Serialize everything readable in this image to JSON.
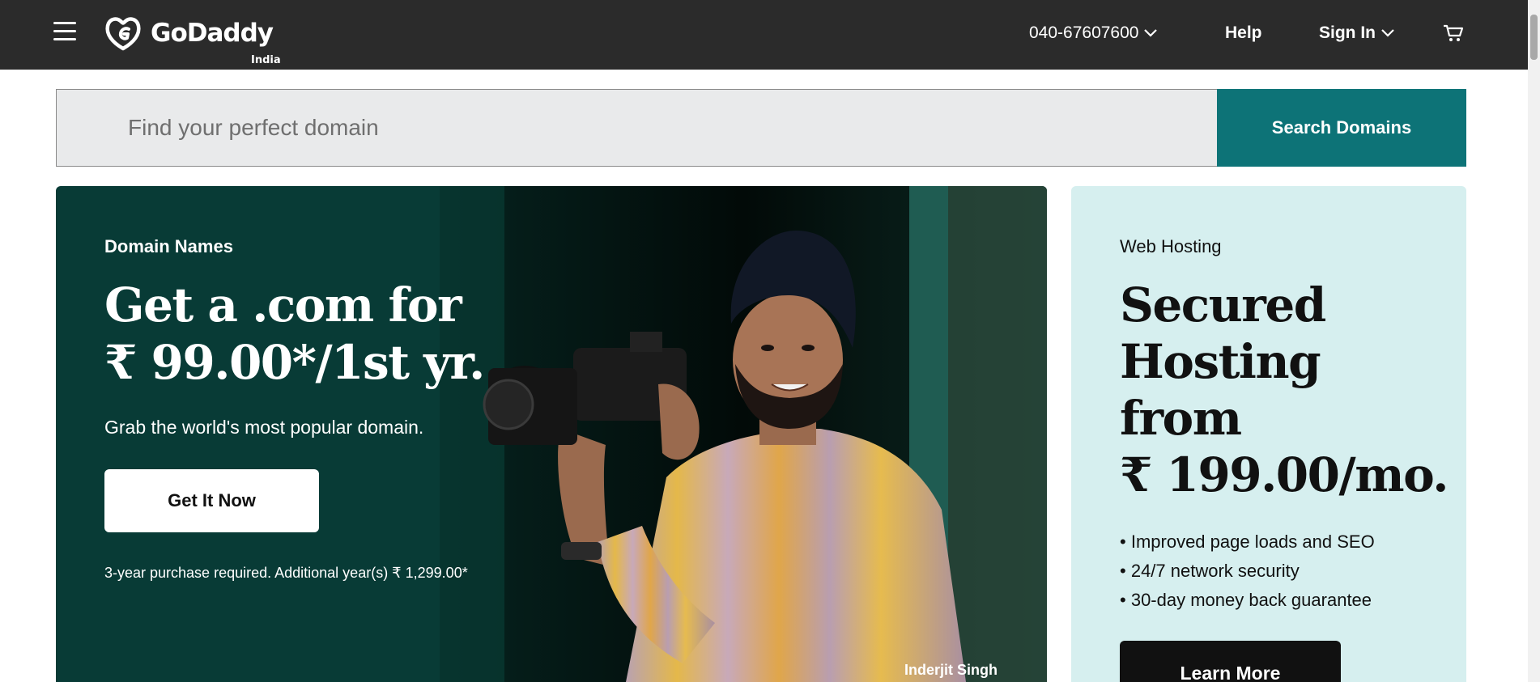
{
  "header": {
    "logo_text": "GoDaddy",
    "region": "India",
    "phone": "040-67607600",
    "help_label": "Help",
    "signin_label": "Sign In"
  },
  "search": {
    "placeholder": "Find your perfect domain",
    "button_label": "Search Domains"
  },
  "hero": {
    "eyebrow": "Domain Names",
    "headline_line1": "Get a .com for",
    "headline_line2": "₹ 99.00*/1st yr.",
    "subtitle": "Grab the world's most popular domain.",
    "cta_label": "Get It Now",
    "fine_print": "3-year purchase required. Additional year(s) ₹ 1,299.00*",
    "photo_credit": "Inderjit Singh"
  },
  "hosting": {
    "eyebrow": "Web Hosting",
    "headline_line1": "Secured",
    "headline_line2": "Hosting",
    "headline_line3": "from",
    "headline_line4": "₹ 199.00/mo.",
    "features": [
      "Improved page loads and SEO",
      "24/7 network security",
      "30-day money back guarantee"
    ],
    "cta_label": "Learn More"
  },
  "colors": {
    "header_bg": "#2b2b2b",
    "search_button": "#0d7377",
    "hero_bg": "#083b36",
    "hosting_bg": "#d6efef"
  },
  "icons": {
    "menu": "hamburger-icon",
    "cart": "cart-icon",
    "dropdown": "chevron-down-icon"
  }
}
